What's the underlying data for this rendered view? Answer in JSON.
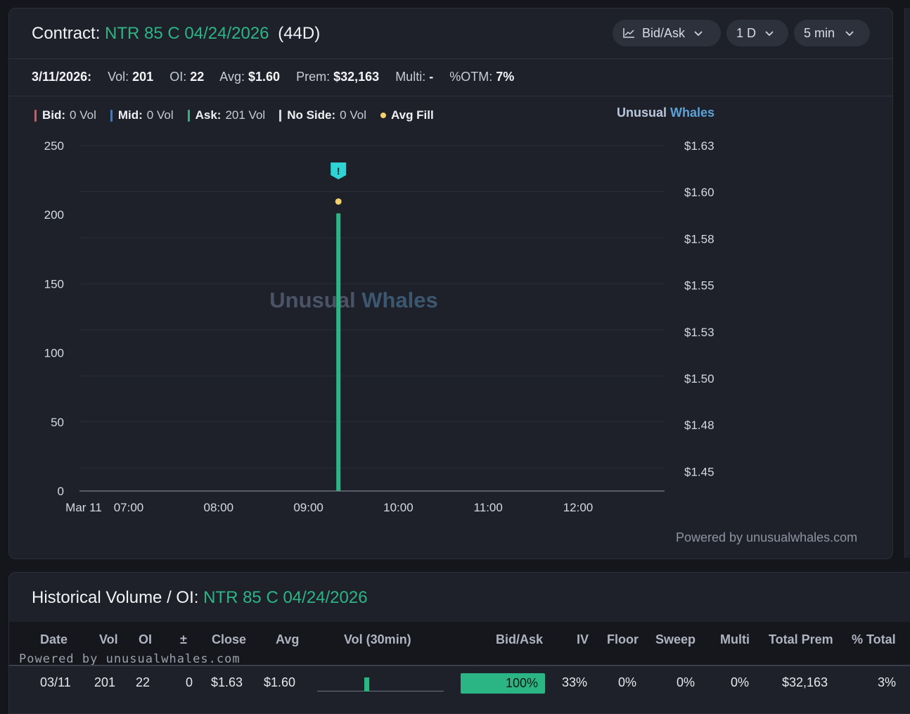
{
  "contract": {
    "label": "Contract:",
    "symbol": "NTR 85 C 04/24/2026",
    "dte": "(44D)"
  },
  "controls": {
    "chart_mode": "Bid/Ask",
    "range": "1 D",
    "interval": "5 min"
  },
  "stats": {
    "date": "3/11/2026:",
    "vol_label": "Vol:",
    "vol": "201",
    "oi_label": "OI:",
    "oi": "22",
    "avg_label": "Avg:",
    "avg": "$1.60",
    "prem_label": "Prem:",
    "prem": "$32,163",
    "multi_label": "Multi:",
    "multi": "-",
    "otm_label": "%OTM:",
    "otm": "7%"
  },
  "legend": {
    "bid_label": "Bid:",
    "bid_value": "0 Vol",
    "bid_color": "#e0505e",
    "mid_label": "Mid:",
    "mid_value": "0 Vol",
    "mid_color": "#2f7de1",
    "ask_label": "Ask:",
    "ask_value": "201 Vol",
    "ask_color": "#2bb585",
    "noside_label": "No Side:",
    "noside_value": "0 Vol",
    "noside_color": "#d0d4dc",
    "avgfill_label": "Avg Fill",
    "avgfill_color": "#f2d06b"
  },
  "brand": {
    "part1": "Unusual",
    "part2": "Whales"
  },
  "watermark": {
    "part1": "Unusual",
    "part2": "Whales"
  },
  "chart_data": {
    "type": "bar",
    "y_left_ticks": [
      "250",
      "200",
      "150",
      "100",
      "50",
      "0"
    ],
    "y_right_ticks": [
      "$1.63",
      "$1.60",
      "$1.58",
      "$1.55",
      "$1.53",
      "$1.50",
      "$1.48",
      "$1.45"
    ],
    "x_ticks": [
      "Mar 11",
      "07:00",
      "08:00",
      "09:00",
      "10:00",
      "11:00",
      "12:00"
    ],
    "ylim_left": [
      0,
      250
    ],
    "series": [
      {
        "name": "Ask",
        "color": "#2bb585",
        "points": [
          {
            "time": "09:20",
            "value": 201
          }
        ]
      }
    ],
    "avg_fill": [
      {
        "time": "09:20",
        "price": 1.6
      }
    ],
    "flag_marker": {
      "time": "09:20",
      "symbol": "!"
    },
    "grid": true
  },
  "powered_by": "Powered by unusualwhales.com",
  "historical": {
    "title": "Historical Volume / OI:",
    "symbol": "NTR 85 C 04/24/2026",
    "powered_by": "Powered by unusualwhales.com",
    "columns": [
      "Date",
      "Vol",
      "OI",
      "±",
      "Close",
      "Avg",
      "Vol (30min)",
      "Bid/Ask",
      "IV",
      "Floor",
      "Sweep",
      "Multi",
      "Total Prem",
      "% Total"
    ],
    "row": {
      "date": "03/11",
      "vol": "201",
      "oi": "22",
      "change": "0",
      "close": "$1.63",
      "avg": "$1.60",
      "vol30_fraction": 1.0,
      "bidask": "100%",
      "bidask_fraction": 1.0,
      "iv": "33%",
      "floor": "0%",
      "sweep": "0%",
      "multi": "0%",
      "total_prem": "$32,163",
      "pct_total": "3%"
    }
  }
}
